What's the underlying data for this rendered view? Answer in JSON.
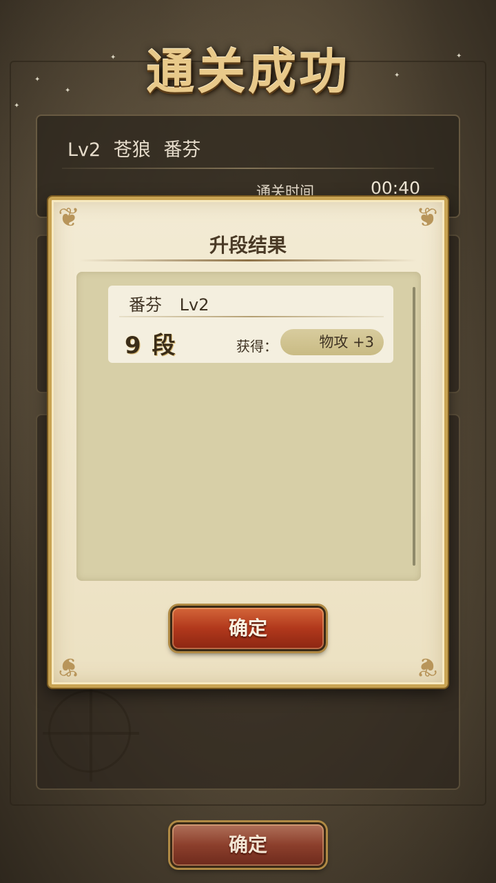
{
  "title": "通关成功",
  "result": {
    "stage": "Lv2",
    "name": "苍狼",
    "character": "番芬",
    "time_label": "通关时间",
    "time_value": "00:40"
  },
  "modal": {
    "title": "升段结果",
    "item": {
      "name": "番芬",
      "level": "Lv2",
      "rank": "9 段",
      "gain_label": "获得：",
      "gain_value": "物攻  +3"
    },
    "confirm_label": "确定"
  },
  "footer": {
    "confirm_label": "确定"
  },
  "colors": {
    "button_red": "#b1381c",
    "modal_bg": "#f3ebd4",
    "gold_border": "#c9a453"
  }
}
